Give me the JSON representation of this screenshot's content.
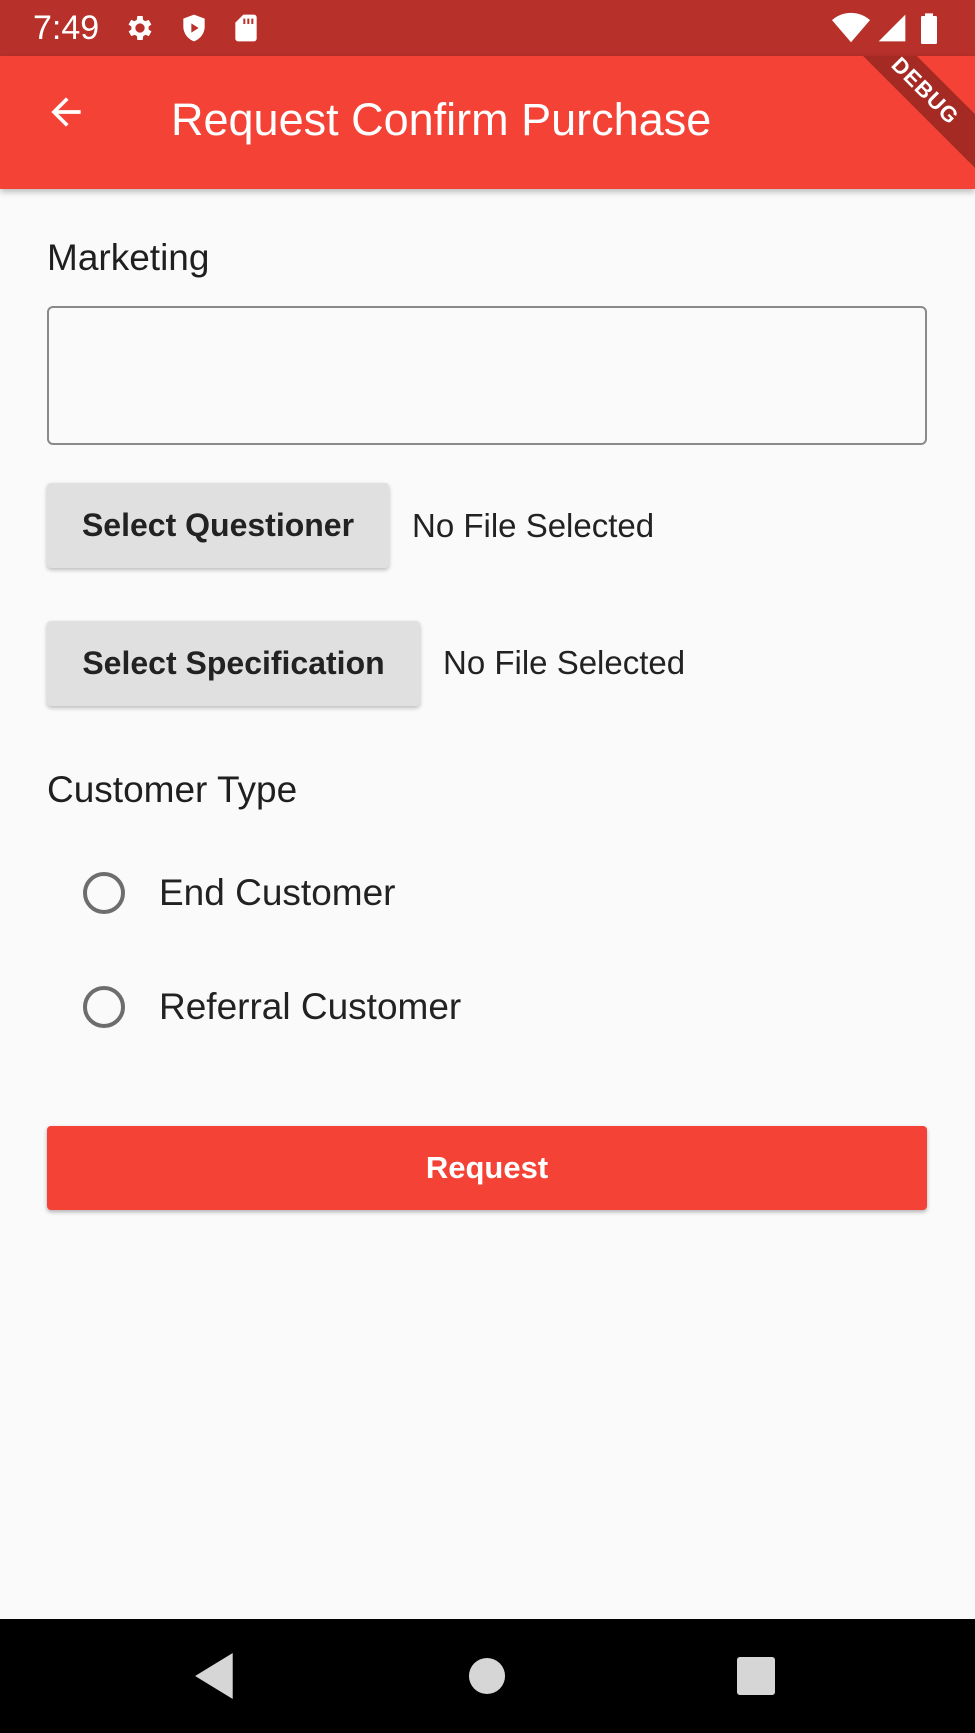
{
  "status_bar": {
    "time": "7:49",
    "left_icons": [
      "gear-icon",
      "shield-icon",
      "sd-card-icon"
    ],
    "right_icons": [
      "wifi-icon",
      "signal-icon",
      "battery-icon"
    ],
    "debug_label": "DEBUG"
  },
  "app_bar": {
    "title": "Request Confirm Purchase",
    "back_icon": "arrow-back-icon",
    "color": "#f44336"
  },
  "form": {
    "marketing_label": "Marketing",
    "marketing_value": "",
    "questioner": {
      "button_label": "Select Questioner",
      "status": "No File Selected"
    },
    "specification": {
      "button_label": "Select Specification",
      "status": "No File Selected"
    },
    "customer_type_label": "Customer Type",
    "customer_type_options": [
      {
        "label": "End Customer",
        "selected": false
      },
      {
        "label": "Referral Customer",
        "selected": false
      }
    ],
    "submit_label": "Request"
  },
  "nav_bar": {
    "buttons": [
      "back-triangle-icon",
      "home-circle-icon",
      "recents-square-icon"
    ]
  }
}
